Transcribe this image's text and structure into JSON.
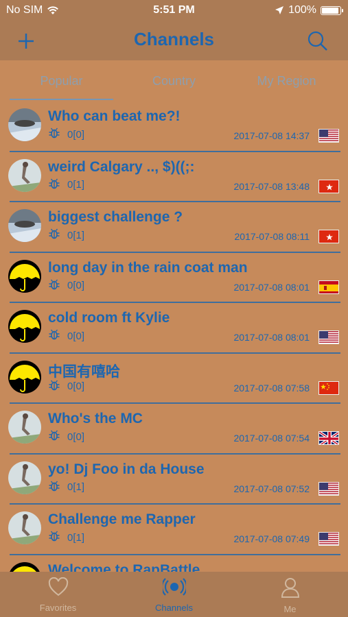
{
  "status": {
    "carrier": "No SIM",
    "time": "5:51 PM",
    "battery": "100%"
  },
  "nav": {
    "title": "Channels"
  },
  "tabs": [
    {
      "label": "Popular",
      "active": true
    },
    {
      "label": "Country",
      "active": false
    },
    {
      "label": "My Region",
      "active": false
    }
  ],
  "channels": [
    {
      "title": "Who can beat me?!",
      "count": "0[0]",
      "date": "2017-07-08 14:37",
      "flag": "us-flag-icon",
      "avatar": "car-avatar"
    },
    {
      "title": "weird Calgary .., $)((;:",
      "count": "0[1]",
      "date": "2017-07-08 13:48",
      "flag": "hk-flag-icon",
      "avatar": "person-avatar"
    },
    {
      "title": "biggest challenge ?",
      "count": "0[1]",
      "date": "2017-07-08 08:11",
      "flag": "hk-flag-icon",
      "avatar": "car-avatar"
    },
    {
      "title": "long day in the rain coat man",
      "count": "0[0]",
      "date": "2017-07-08 08:01",
      "flag": "es-flag-icon",
      "avatar": "umbrella-avatar"
    },
    {
      "title": "cold room ft Kylie",
      "count": "0[0]",
      "date": "2017-07-08 08:01",
      "flag": "us-flag-icon",
      "avatar": "umbrella-avatar"
    },
    {
      "title": "中国有嘻哈",
      "count": "0[0]",
      "date": "2017-07-08 07:58",
      "flag": "cn-flag-icon",
      "avatar": "umbrella-avatar"
    },
    {
      "title": "Who's the MC",
      "count": "0[0]",
      "date": "2017-07-08 07:54",
      "flag": "uk-flag-icon",
      "avatar": "person-avatar"
    },
    {
      "title": "yo! Dj Foo in da House",
      "count": "0[1]",
      "date": "2017-07-08 07:52",
      "flag": "us-flag-icon",
      "avatar": "person-avatar"
    },
    {
      "title": "Challenge me Rapper",
      "count": "0[1]",
      "date": "2017-07-08 07:49",
      "flag": "us-flag-icon",
      "avatar": "person-avatar"
    },
    {
      "title": "Welcome to RapBattle",
      "count": "",
      "date": "",
      "flag": "",
      "avatar": "umbrella-avatar"
    }
  ],
  "tabbar": [
    {
      "label": "Favorites",
      "icon": "heart-icon",
      "active": false
    },
    {
      "label": "Channels",
      "icon": "broadcast-icon",
      "active": true
    },
    {
      "label": "Me",
      "icon": "person-icon",
      "active": false
    }
  ],
  "colors": {
    "background": "#c68a5b",
    "bar": "#ab7b55",
    "accent": "#1d66b0",
    "inactive": "#8e9fae"
  }
}
